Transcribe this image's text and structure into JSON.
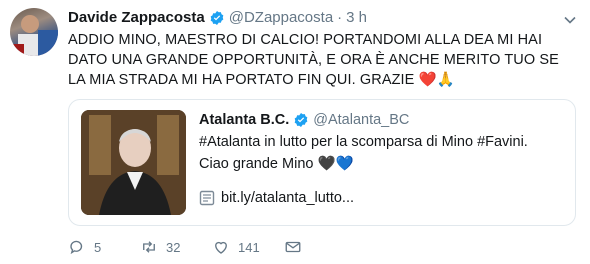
{
  "tweet": {
    "author_name": "Davide Zappacosta",
    "author_handle": "@DZappacosta",
    "separator": "·",
    "time": "3 h",
    "text_main": "ADDIO MINO, MAESTRO DI CALCIO! PORTANDOMI ALLA DEA MI HAI DATO UNA GRANDE OPPORTUNITÀ, E ORA È ANCHE MERITO TUO SE LA MIA STRADA MI HA PORTATO FIN QUI. GRAZIE",
    "emoji_1": "❤️",
    "emoji_2": "🙏"
  },
  "quoted": {
    "author_name": "Atalanta B.C.",
    "author_handle": "@Atalanta_BC",
    "line1": "#Atalanta in lutto per la scomparsa di Mino #Favini.",
    "line2": "Ciao grande Mino",
    "emoji_1": "🖤",
    "emoji_2": "💙",
    "link": "bit.ly/atalanta_lutto..."
  },
  "actions": {
    "replies": "5",
    "retweets": "32",
    "likes": "141"
  },
  "colors": {
    "accent": "#1da1f2",
    "secondary_text": "#657786",
    "heart_red": "#e0245e"
  }
}
